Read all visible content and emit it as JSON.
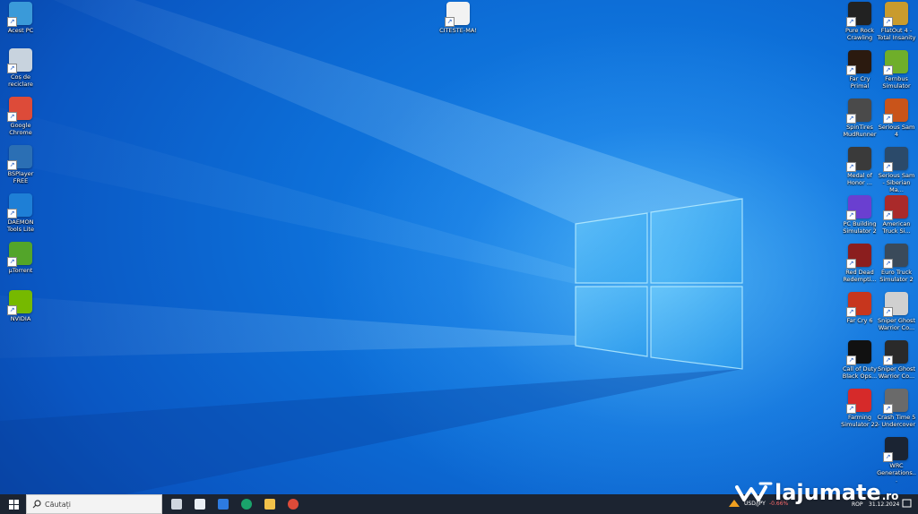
{
  "desktop": {
    "left_icons": [
      {
        "label": "Acest PC",
        "icon": "this-pc-icon",
        "color": "#3a9ad9"
      },
      {
        "label": "Coș de reciclare",
        "icon": "recycle-bin-icon",
        "color": "#c8d3de"
      },
      {
        "label": "Google Chrome",
        "icon": "chrome-icon",
        "color": "#dd4b39"
      },
      {
        "label": "BSPlayer FREE",
        "icon": "bsplayer-icon",
        "color": "#2b6fb4"
      },
      {
        "label": "DAEMON Tools Lite",
        "icon": "daemon-tools-icon",
        "color": "#1e7fd6"
      },
      {
        "label": "µTorrent",
        "icon": "utorrent-icon",
        "color": "#53a52a"
      },
      {
        "label": "NVIDIA",
        "icon": "nvidia-icon",
        "color": "#76b900"
      }
    ],
    "center_icons": [
      {
        "label": "CITESTE-MA!",
        "icon": "text-file-icon",
        "color": "#f2f2f2"
      }
    ],
    "right_col1_icons": [
      {
        "label": "Pure Rock Crawling",
        "icon": "pure-rock-crawling-icon",
        "color": "#222222"
      },
      {
        "label": "Far Cry Primal",
        "icon": "far-cry-primal-icon",
        "color": "#2b1a0f"
      },
      {
        "label": "SpinTires MudRunner",
        "icon": "spintires-mudrunner-icon",
        "color": "#4a4a4a"
      },
      {
        "label": "Medal of Honor ...",
        "icon": "medal-of-honor-icon",
        "color": "#3a3a3a"
      },
      {
        "label": "PC Building Simulator 2",
        "icon": "pc-building-simulator-icon",
        "color": "#6a3fd0"
      },
      {
        "label": "Red Dead Redempti...",
        "icon": "red-dead-redemption-icon",
        "color": "#8b1e1e"
      },
      {
        "label": "Far Cry 6",
        "icon": "far-cry-6-icon",
        "color": "#c7361d"
      },
      {
        "label": "Call of Duty Black Ops...",
        "icon": "call-of-duty-icon",
        "color": "#111111"
      },
      {
        "label": "Farming Simulator 22",
        "icon": "farming-simulator-icon",
        "color": "#d62a2a"
      }
    ],
    "right_col2_icons": [
      {
        "label": "FlatOut 4 - Total Insanity",
        "icon": "flatout-icon",
        "color": "#c99b2d"
      },
      {
        "label": "Fernbus Simulator",
        "icon": "fernbus-simulator-icon",
        "color": "#6fae2a"
      },
      {
        "label": "Serious Sam 4",
        "icon": "serious-sam-4-icon",
        "color": "#c9541a"
      },
      {
        "label": "Serious Sam - Siberian Ma...",
        "icon": "serious-sam-siberian-icon",
        "color": "#2b4a6a"
      },
      {
        "label": "American Truck Si...",
        "icon": "american-truck-simulator-icon",
        "color": "#aa2a2a"
      },
      {
        "label": "Euro Truck Simulator 2",
        "icon": "euro-truck-simulator-icon",
        "color": "#3a4a5a"
      },
      {
        "label": "Sniper Ghost Warrior Co...",
        "icon": "sniper-ghost-warrior-icon",
        "color": "#d0d0d0"
      },
      {
        "label": "Sniper Ghost Warrior Co...",
        "icon": "sniper-ghost-warrior-2-icon",
        "color": "#2a2a2a"
      },
      {
        "label": "Crash Time 5 - Undercover",
        "icon": "crash-time-icon",
        "color": "#6a6a6a"
      },
      {
        "label": "WRC Generations...",
        "icon": "wrc-generations-icon",
        "color": "#1b2433"
      }
    ]
  },
  "taskbar": {
    "search_placeholder": "Căutați",
    "pinned": [
      {
        "icon": "task-view-icon"
      },
      {
        "icon": "store-icon"
      },
      {
        "icon": "mail-icon"
      },
      {
        "icon": "edge-icon"
      },
      {
        "icon": "file-explorer-icon"
      },
      {
        "icon": "chrome-icon"
      }
    ],
    "ticker": "USD/JPY",
    "ticker_change": "-0.66%",
    "language": "ROP",
    "date": "31.12.2024"
  },
  "watermark": {
    "text": "lajumate",
    "suffix": ".ro"
  },
  "colors": {
    "taskbar": "#1c2431",
    "desktop": "#0d6fd8",
    "logo_glow": "#7fd8ff"
  }
}
